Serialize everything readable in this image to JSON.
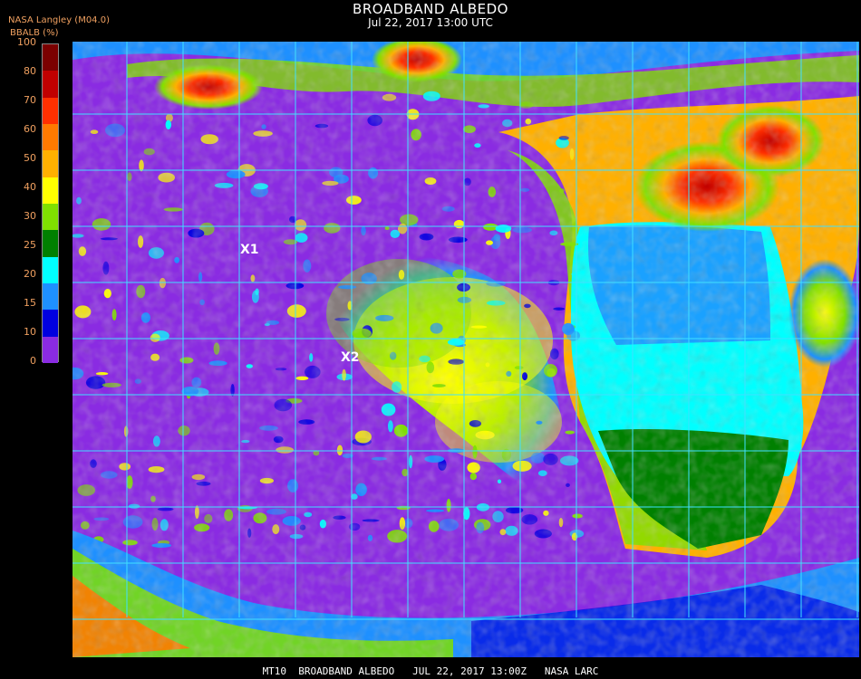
{
  "header": {
    "title": "BROADBAND ALBEDO",
    "subtitle": "Jul 22, 2017 13:00 UTC",
    "source": "NASA Langley (M04.0)"
  },
  "colorbar": {
    "label": "BBALB (%)",
    "ticks": [
      "100",
      "80",
      "70",
      "60",
      "50",
      "40",
      "30",
      "25",
      "20",
      "15",
      "10",
      "0"
    ],
    "colors": [
      "#7b0000",
      "#c00000",
      "#ff3000",
      "#ff7a00",
      "#ffb000",
      "#ffff00",
      "#80e000",
      "#008000",
      "#00ffff",
      "#1e90ff",
      "#0000e0",
      "#8a2be2"
    ]
  },
  "markers": [
    {
      "label": "X1"
    },
    {
      "label": "X2"
    }
  ],
  "footer": "MT10  BROADBAND ALBEDO   JUL 22, 2017 13:00Z   NASA LARC"
}
